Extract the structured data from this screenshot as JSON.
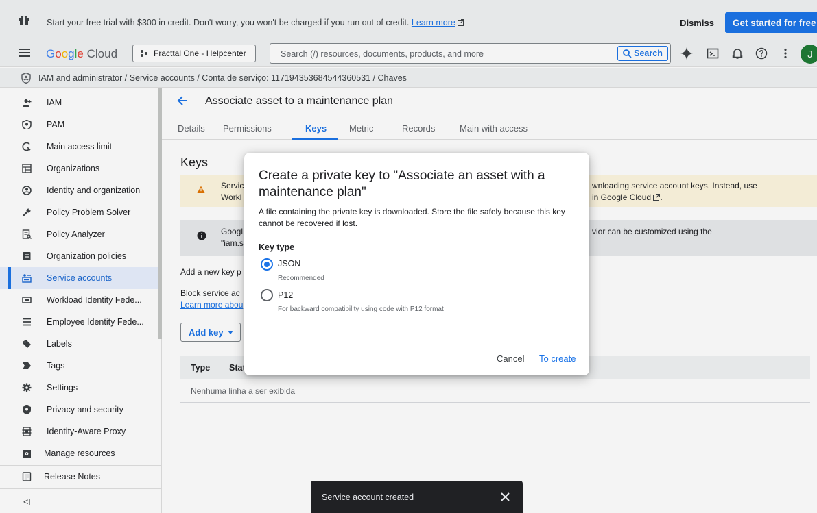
{
  "banner": {
    "message": "Start your free trial with $300 in credit. Don't worry, you won't be charged if you run out of credit.",
    "learn_more": "Learn more",
    "dismiss": "Dismiss",
    "get_started": "Get started for free"
  },
  "topbar": {
    "logo_google": [
      "G",
      "o",
      "o",
      "g",
      "l",
      "e"
    ],
    "logo_cloud": "Cloud",
    "project": "Fracttal One - Helpcenter",
    "search_placeholder": "Search (/) resources, documents, products, and more",
    "search_button": "Search",
    "avatar": "J"
  },
  "breadcrumb": {
    "text": "IAM and administrator  /  Service accounts  /  Conta de serviço: 117194353684544360531  /  Chaves"
  },
  "sidebar": {
    "items": [
      {
        "label": "IAM",
        "icon": "person-add-icon"
      },
      {
        "label": "PAM",
        "icon": "shield-key-icon"
      },
      {
        "label": "Main access limit",
        "icon": "access-limit-icon"
      },
      {
        "label": "Organizations",
        "icon": "organization-icon"
      },
      {
        "label": "Identity and organization",
        "icon": "account-circle-icon"
      },
      {
        "label": "Policy Problem Solver",
        "icon": "wrench-icon"
      },
      {
        "label": "Policy Analyzer",
        "icon": "policy-analyzer-icon"
      },
      {
        "label": "Organization policies",
        "icon": "document-icon"
      },
      {
        "label": "Service accounts",
        "icon": "service-account-icon"
      },
      {
        "label": "Workload Identity Fede...",
        "icon": "workload-identity-icon"
      },
      {
        "label": "Employee Identity Fede...",
        "icon": "list-icon"
      },
      {
        "label": "Labels",
        "icon": "label-icon"
      },
      {
        "label": "Tags",
        "icon": "tag-icon"
      },
      {
        "label": "Settings",
        "icon": "gear-icon"
      },
      {
        "label": "Privacy and security",
        "icon": "shield-icon"
      },
      {
        "label": "Identity-Aware Proxy",
        "icon": "proxy-icon"
      }
    ],
    "bottom": [
      {
        "label": "Manage resources",
        "icon": "manage-resources-icon"
      },
      {
        "label": "Release Notes",
        "icon": "release-notes-icon"
      }
    ],
    "collapse": "<I"
  },
  "main": {
    "title": "Associate asset to a maintenance plan",
    "tabs": [
      "Details",
      "Permissions",
      "Keys",
      "Metric",
      "Records",
      "Main with access"
    ],
    "active_tab": "Keys",
    "heading": "Keys",
    "warning": {
      "line1_left": "Servic",
      "line2_left": "Workl",
      "line1_right": "wnloading service account keys. Instead, use",
      "line2_right_text": " in Google Cloud",
      "line2_right_icon": "external-link-icon"
    },
    "info": {
      "line1_left": "Googl",
      "line2_left": "\"iam.s",
      "line1_right": "vior can be customized using the"
    },
    "add_text": "Add a new key p",
    "block_text": "Block service ac",
    "learn_text": "Learn more abou",
    "add_key": "Add key",
    "table": {
      "col_type": "Type",
      "col_status": "Stat",
      "empty": "Nenhuma linha a ser exibida"
    }
  },
  "dialog": {
    "title": "Create a private key to \"Associate an asset with a maintenance plan\"",
    "description": "A file containing the private key is downloaded. Store the file safely because this key cannot be recovered if lost.",
    "key_type_label": "Key type",
    "options": [
      {
        "label": "JSON",
        "sublabel": "Recommended",
        "selected": true
      },
      {
        "label": "P12",
        "sublabel": "For backward compatibility using code with P12 format",
        "selected": false
      }
    ],
    "cancel": "Cancel",
    "create": "To create"
  },
  "snackbar": {
    "message": "Service account created"
  },
  "colors": {
    "accent": "#1a73e8",
    "warning_bg": "#fef7e0",
    "info_bg": "#e8eaed",
    "active_nav_bg": "#e8f0fe"
  }
}
